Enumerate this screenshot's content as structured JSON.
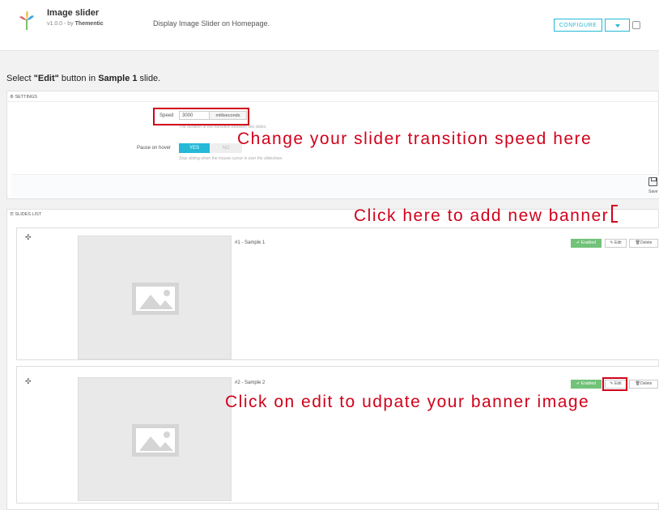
{
  "module": {
    "name": "Image slider",
    "version": "v1.0.0 - by",
    "author": "Thementic",
    "description": "Display Image Slider on Homepage.",
    "configure_label": "CONFIGURE",
    "icon": "image-slider-module-icon"
  },
  "instruction": {
    "prefix": "Select ",
    "button_name": "\"Edit\"",
    "middle": " button in ",
    "slide_name": "Sample 1",
    "suffix": " slide."
  },
  "settings": {
    "header": "SETTINGS",
    "speed_label": "Speed",
    "speed_value": "3000",
    "speed_unit": "milliseconds",
    "speed_help": "The duration of the transition between two slides.",
    "pause_label": "Pause on hover",
    "pause_yes": "YES",
    "pause_no": "NO",
    "pause_selected": "YES",
    "pause_help": "Stop sliding when the mouse cursor is over the slideshow.",
    "save_label": "Save"
  },
  "slides_list": {
    "header": "SLIDES LIST",
    "slides": [
      {
        "title": "#1 - Sample 1",
        "status": "Enabled",
        "edit_label": "Edit",
        "delete_label": "Delete"
      },
      {
        "title": "#2 - Sample 2",
        "status": "Enabled",
        "edit_label": "Edit",
        "delete_label": "Delete"
      }
    ]
  },
  "callouts": {
    "speed": "Change your slider transition speed here",
    "add_banner": "Click here to add new banner",
    "edit": "Click on edit to udpate your banner image"
  },
  "colors": {
    "accent": "#25b9d7",
    "enabled": "#72c279",
    "callout": "#d0021b"
  }
}
